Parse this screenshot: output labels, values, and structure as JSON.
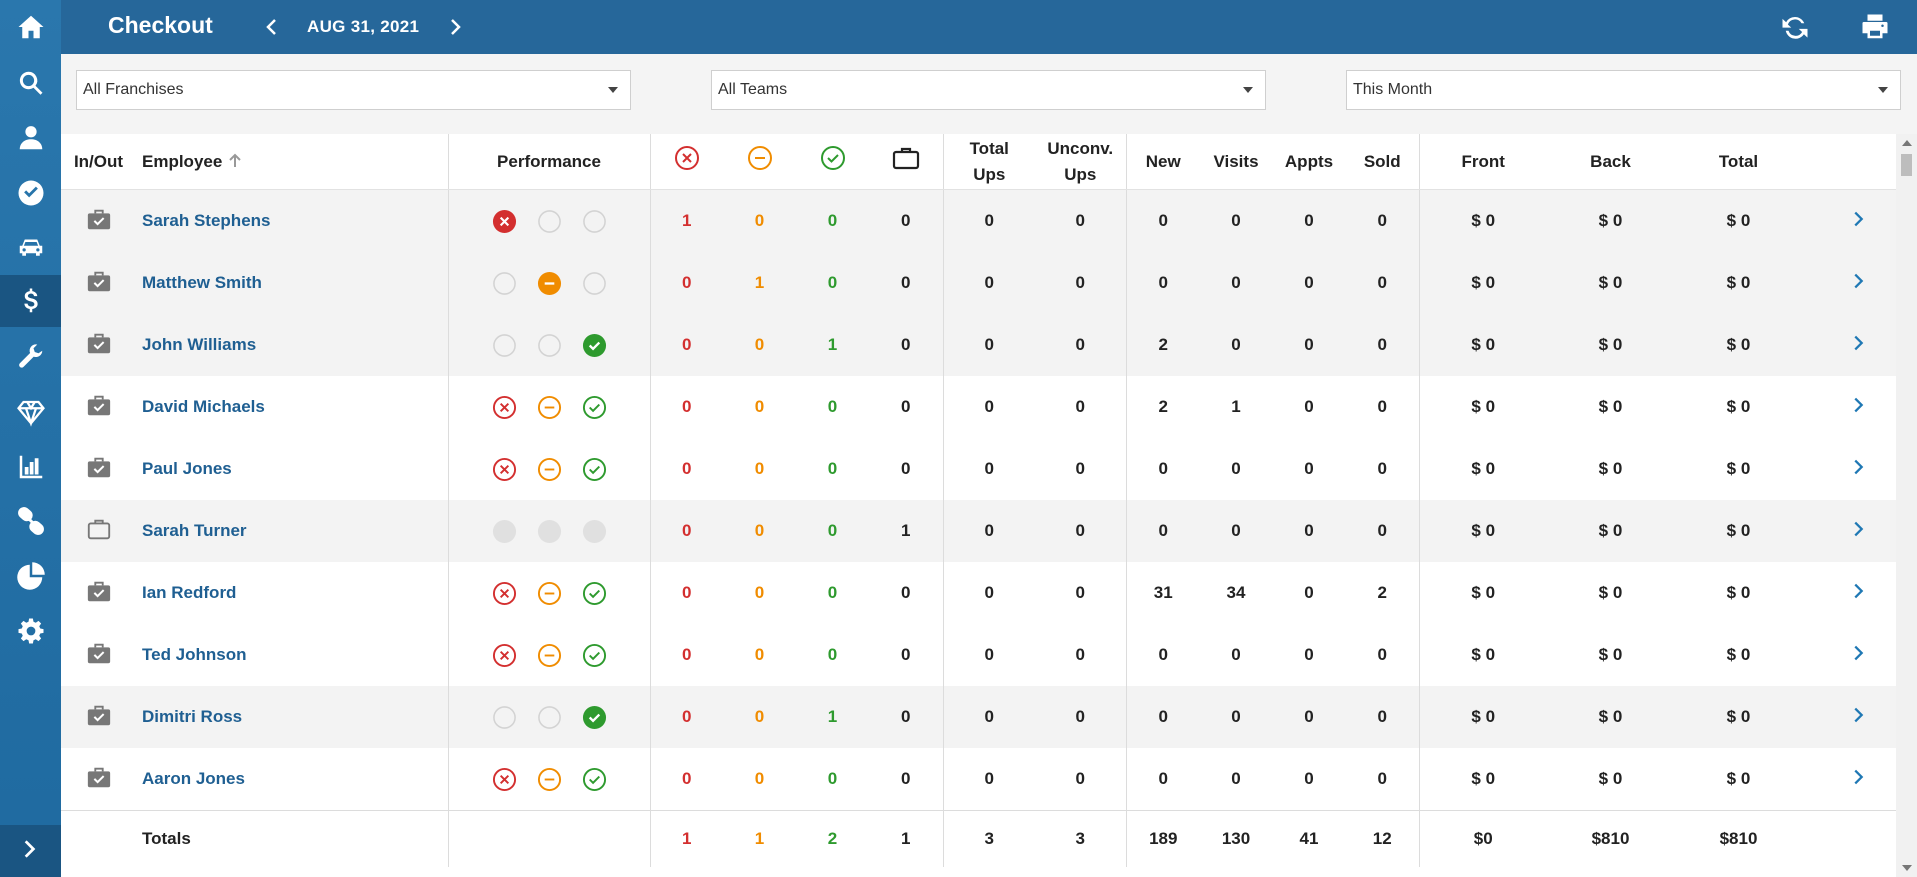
{
  "header": {
    "title": "Checkout",
    "date": "AUG 31, 2021"
  },
  "sidebar": {
    "items": [
      {
        "icon": "home-icon"
      },
      {
        "icon": "search-icon"
      },
      {
        "icon": "user-icon"
      },
      {
        "icon": "check-circle-icon"
      },
      {
        "icon": "car-icon"
      },
      {
        "icon": "dollar-icon",
        "active": true
      },
      {
        "icon": "wrench-icon"
      },
      {
        "icon": "diamond-icon"
      },
      {
        "icon": "bar-chart-icon"
      },
      {
        "icon": "link-icon"
      },
      {
        "icon": "pie-chart-icon"
      },
      {
        "icon": "gear-icon"
      }
    ],
    "expand_icon": "chevron-right-icon"
  },
  "filters": {
    "franchise": "All Franchises",
    "team": "All Teams",
    "period": "This Month"
  },
  "columns": {
    "inout": "In/Out",
    "employee": "Employee",
    "performance": "Performance",
    "total_ups_1": "Total",
    "total_ups_2": "Ups",
    "unconv_1": "Unconv.",
    "unconv_2": "Ups",
    "new": "New",
    "visits": "Visits",
    "appts": "Appts",
    "sold": "Sold",
    "front": "Front",
    "back": "Back",
    "total": "Total"
  },
  "rows": [
    {
      "name": "Sarah Stephens",
      "status": "in",
      "perf": [
        "red-filled",
        "empty",
        "empty"
      ],
      "fail": "1",
      "neutral": "0",
      "pass": "0",
      "out": "0",
      "total_ups": "0",
      "unconv": "0",
      "new": "0",
      "visits": "0",
      "appts": "0",
      "sold": "0",
      "front": "$ 0",
      "back": "$ 0",
      "total": "$ 0"
    },
    {
      "name": "Matthew Smith",
      "status": "in",
      "perf": [
        "empty",
        "orange-filled",
        "empty"
      ],
      "fail": "0",
      "neutral": "1",
      "pass": "0",
      "out": "0",
      "total_ups": "0",
      "unconv": "0",
      "new": "0",
      "visits": "0",
      "appts": "0",
      "sold": "0",
      "front": "$ 0",
      "back": "$ 0",
      "total": "$ 0"
    },
    {
      "name": "John Williams",
      "status": "in",
      "perf": [
        "empty",
        "empty",
        "green-filled"
      ],
      "fail": "0",
      "neutral": "0",
      "pass": "1",
      "out": "0",
      "total_ups": "0",
      "unconv": "0",
      "new": "2",
      "visits": "0",
      "appts": "0",
      "sold": "0",
      "front": "$ 0",
      "back": "$ 0",
      "total": "$ 0"
    },
    {
      "name": "David Michaels",
      "status": "in",
      "perf": [
        "red",
        "orange",
        "green"
      ],
      "fail": "0",
      "neutral": "0",
      "pass": "0",
      "out": "0",
      "total_ups": "0",
      "unconv": "0",
      "new": "2",
      "visits": "1",
      "appts": "0",
      "sold": "0",
      "front": "$ 0",
      "back": "$ 0",
      "total": "$ 0"
    },
    {
      "name": "Paul Jones",
      "status": "in",
      "perf": [
        "red",
        "orange",
        "green"
      ],
      "fail": "0",
      "neutral": "0",
      "pass": "0",
      "out": "0",
      "total_ups": "0",
      "unconv": "0",
      "new": "0",
      "visits": "0",
      "appts": "0",
      "sold": "0",
      "front": "$ 0",
      "back": "$ 0",
      "total": "$ 0"
    },
    {
      "name": "Sarah Turner",
      "status": "out",
      "perf": [
        "gray",
        "gray",
        "gray"
      ],
      "fail": "0",
      "neutral": "0",
      "pass": "0",
      "out": "1",
      "total_ups": "0",
      "unconv": "0",
      "new": "0",
      "visits": "0",
      "appts": "0",
      "sold": "0",
      "front": "$ 0",
      "back": "$ 0",
      "total": "$ 0"
    },
    {
      "name": "Ian Redford",
      "status": "in",
      "perf": [
        "red",
        "orange",
        "green"
      ],
      "fail": "0",
      "neutral": "0",
      "pass": "0",
      "out": "0",
      "total_ups": "0",
      "unconv": "0",
      "new": "31",
      "visits": "34",
      "appts": "0",
      "sold": "2",
      "front": "$ 0",
      "back": "$ 0",
      "total": "$ 0"
    },
    {
      "name": "Ted Johnson",
      "status": "in",
      "perf": [
        "red",
        "orange",
        "green"
      ],
      "fail": "0",
      "neutral": "0",
      "pass": "0",
      "out": "0",
      "total_ups": "0",
      "unconv": "0",
      "new": "0",
      "visits": "0",
      "appts": "0",
      "sold": "0",
      "front": "$ 0",
      "back": "$ 0",
      "total": "$ 0"
    },
    {
      "name": "Dimitri Ross",
      "status": "in",
      "perf": [
        "empty",
        "empty",
        "green-filled"
      ],
      "fail": "0",
      "neutral": "0",
      "pass": "1",
      "out": "0",
      "total_ups": "0",
      "unconv": "0",
      "new": "0",
      "visits": "0",
      "appts": "0",
      "sold": "0",
      "front": "$ 0",
      "back": "$ 0",
      "total": "$ 0"
    },
    {
      "name": "Aaron Jones",
      "status": "in",
      "perf": [
        "red",
        "orange",
        "green"
      ],
      "fail": "0",
      "neutral": "0",
      "pass": "0",
      "out": "0",
      "total_ups": "0",
      "unconv": "0",
      "new": "0",
      "visits": "0",
      "appts": "0",
      "sold": "0",
      "front": "$ 0",
      "back": "$ 0",
      "total": "$ 0"
    }
  ],
  "totals": {
    "label": "Totals",
    "fail": "1",
    "neutral": "1",
    "pass": "2",
    "out": "1",
    "total_ups": "3",
    "unconv": "3",
    "new": "189",
    "visits": "130",
    "appts": "41",
    "sold": "12",
    "front": "$0",
    "back": "$810",
    "total": "$810"
  },
  "colors": {
    "red": "#d32f2f",
    "orange": "#f08c00",
    "green": "#2e9a2e",
    "link": "#1f5f92",
    "header": "#26679a",
    "sidebar": "#2a77ad"
  }
}
